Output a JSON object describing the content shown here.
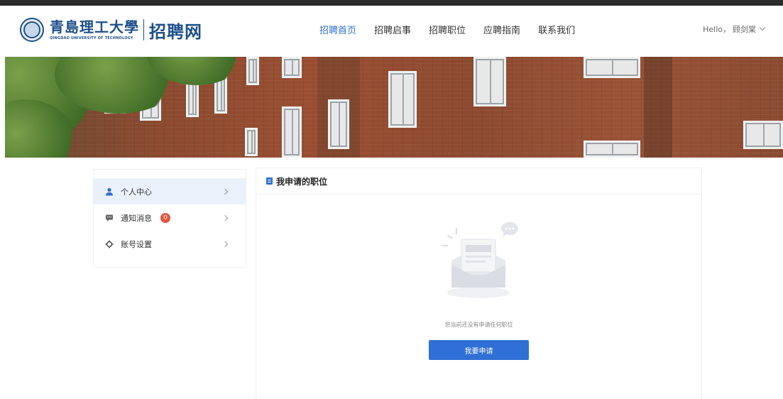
{
  "header": {
    "university_cn": "青島理工大學",
    "university_en": "QINGDAO UNIVERSITY OF TECHNOLOGY",
    "site_name": "招聘网"
  },
  "nav": {
    "items": [
      {
        "label": "招聘首页",
        "active": true
      },
      {
        "label": "招聘启事",
        "active": false
      },
      {
        "label": "招聘职位",
        "active": false
      },
      {
        "label": "应聘指南",
        "active": false
      },
      {
        "label": "联系我们",
        "active": false
      }
    ]
  },
  "user": {
    "greeting": "Hello，",
    "name": "顾剑棠"
  },
  "sidebar": {
    "items": [
      {
        "label": "个人中心",
        "icon": "user-icon",
        "active": true
      },
      {
        "label": "通知消息",
        "icon": "message-icon",
        "badge": "0",
        "active": false
      },
      {
        "label": "账号设置",
        "icon": "settings-icon",
        "active": false
      }
    ]
  },
  "main": {
    "title": "我申请的职位",
    "empty_text": "您当前还没有申请任何职位",
    "apply_button": "我要申请"
  },
  "colors": {
    "accent": "#2f6fd6",
    "brand": "#1d4f8c",
    "badge": "#e4553e"
  }
}
